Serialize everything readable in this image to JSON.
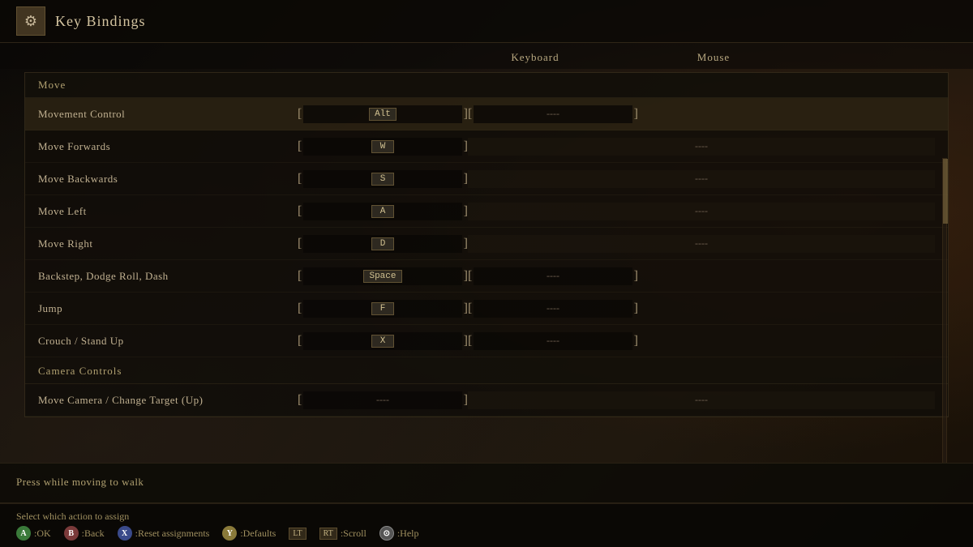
{
  "title": {
    "icon": "⚙",
    "label": "Key Bindings"
  },
  "columns": {
    "keyboard": "Keyboard",
    "mouse": "Mouse"
  },
  "sections": [
    {
      "id": "move",
      "label": "Move",
      "bindings": [
        {
          "id": "movement-control",
          "action": "Movement Control",
          "key": "Alt",
          "mouse": "----",
          "mouse_filled": false,
          "active": true
        },
        {
          "id": "move-forwards",
          "action": "Move Forwards",
          "key": "W",
          "mouse": "----",
          "mouse_filled": true,
          "active": false
        },
        {
          "id": "move-backwards",
          "action": "Move Backwards",
          "key": "S",
          "mouse": "----",
          "mouse_filled": true,
          "active": false
        },
        {
          "id": "move-left",
          "action": "Move Left",
          "key": "A",
          "mouse": "----",
          "mouse_filled": true,
          "active": false
        },
        {
          "id": "move-right",
          "action": "Move Right",
          "key": "D",
          "mouse": "----",
          "mouse_filled": true,
          "active": false
        },
        {
          "id": "backstep",
          "action": "Backstep, Dodge Roll, Dash",
          "key": "Space",
          "mouse": "----",
          "mouse_filled": false,
          "active": false
        },
        {
          "id": "jump",
          "action": "Jump",
          "key": "F",
          "mouse": "----",
          "mouse_filled": false,
          "active": false
        },
        {
          "id": "crouch",
          "action": "Crouch / Stand Up",
          "key": "X",
          "mouse": "----",
          "mouse_filled": false,
          "active": false
        }
      ]
    },
    {
      "id": "camera",
      "label": "Camera Controls",
      "bindings": [
        {
          "id": "move-camera-up",
          "action": "Move Camera / Change Target (Up)",
          "key": "----",
          "mouse": "----",
          "mouse_filled": true,
          "active": false
        }
      ]
    }
  ],
  "description": "Press while moving to walk",
  "bottom": {
    "assign_label": "Select which action to assign",
    "controls": [
      {
        "badge": "A",
        "badge_type": "circle",
        "color": "ctrl-a",
        "label": ":OK"
      },
      {
        "badge": "B",
        "badge_type": "circle",
        "color": "ctrl-b",
        "label": ":Back"
      },
      {
        "badge": "X",
        "badge_type": "circle",
        "color": "ctrl-x",
        "label": ":Reset assignments"
      },
      {
        "badge": "Y",
        "badge_type": "circle",
        "color": "ctrl-y",
        "label": ":Defaults"
      },
      {
        "badge": "LT",
        "badge_type": "square",
        "color": "",
        "label": ""
      },
      {
        "badge": "RT",
        "badge_type": "square",
        "color": "",
        "label": ":Scroll"
      },
      {
        "badge": "⊙",
        "badge_type": "circle",
        "color": "ctrl-b",
        "label": ":Help"
      }
    ]
  }
}
